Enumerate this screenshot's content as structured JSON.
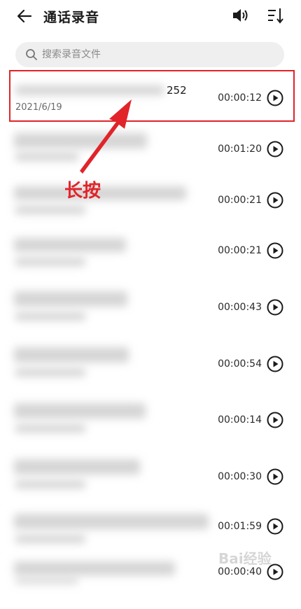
{
  "header": {
    "title": "通话录音"
  },
  "search": {
    "placeholder": "搜索录音文件"
  },
  "recordings": [
    {
      "name_visible": "252",
      "date": "2021/6/19",
      "duration": "00:00:12"
    },
    {
      "duration": "00:01:20"
    },
    {
      "duration": "00:00:21"
    },
    {
      "duration": "00:00:21"
    },
    {
      "duration": "00:00:43"
    },
    {
      "duration": "00:00:54"
    },
    {
      "duration": "00:00:14"
    },
    {
      "duration": "00:00:30"
    },
    {
      "duration": "00:01:59"
    },
    {
      "duration": "00:00:40"
    }
  ],
  "annotation": {
    "text": "长按"
  },
  "watermark": {
    "text": "Bai经验"
  },
  "colors": {
    "annotation_red": "#e0242a",
    "search_bg": "#efefef"
  },
  "icons": [
    "back-arrow-icon",
    "speaker-icon",
    "sort-icon",
    "search-icon",
    "play-icon"
  ]
}
